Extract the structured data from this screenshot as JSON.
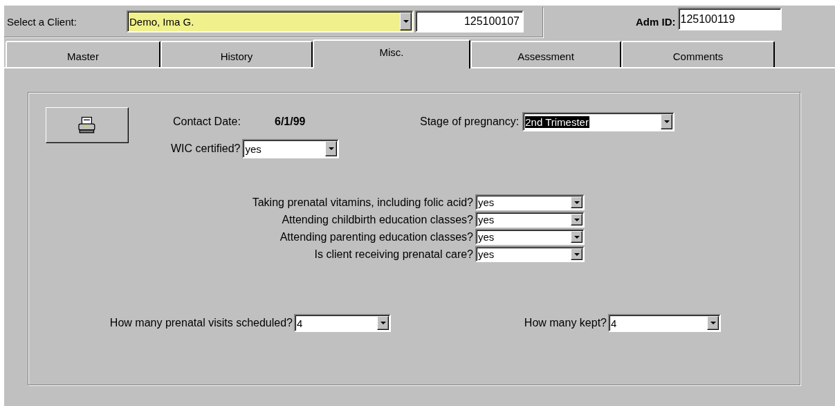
{
  "client_selector": {
    "label": "Select a Client:",
    "value": "Demo, Ima G.",
    "client_id": "125100107",
    "highlighted": false
  },
  "admission": {
    "label": "Adm ID:",
    "value": "125100119"
  },
  "tabs": [
    {
      "label": "Master",
      "selected": false
    },
    {
      "label": "History",
      "selected": false
    },
    {
      "label": "Misc.",
      "selected": true
    },
    {
      "label": "Assessment",
      "selected": false
    },
    {
      "label": "Comments",
      "selected": false
    }
  ],
  "contact_date": {
    "label": "Contact Date:",
    "value": "6/1/99"
  },
  "stage_of_pregnancy": {
    "label": "Stage of pregnancy:",
    "value": "2nd Trimester",
    "highlighted": true
  },
  "wic_certified": {
    "label": "WIC certified?",
    "value": "yes",
    "highlighted": false
  },
  "questions": [
    {
      "label": "Taking prenatal vitamins, including folic acid?",
      "value": "yes",
      "highlighted": false
    },
    {
      "label": "Attending childbirth education classes?",
      "value": "yes",
      "highlighted": false
    },
    {
      "label": "Attending parenting education classes?",
      "value": "yes",
      "highlighted": false
    },
    {
      "label": "Is client receiving prenatal care?",
      "value": "yes",
      "highlighted": false
    }
  ],
  "visits_scheduled": {
    "label": "How many prenatal visits scheduled?",
    "value": "4",
    "highlighted": false
  },
  "visits_kept": {
    "label": "How many kept?",
    "value": "4",
    "highlighted": false
  }
}
